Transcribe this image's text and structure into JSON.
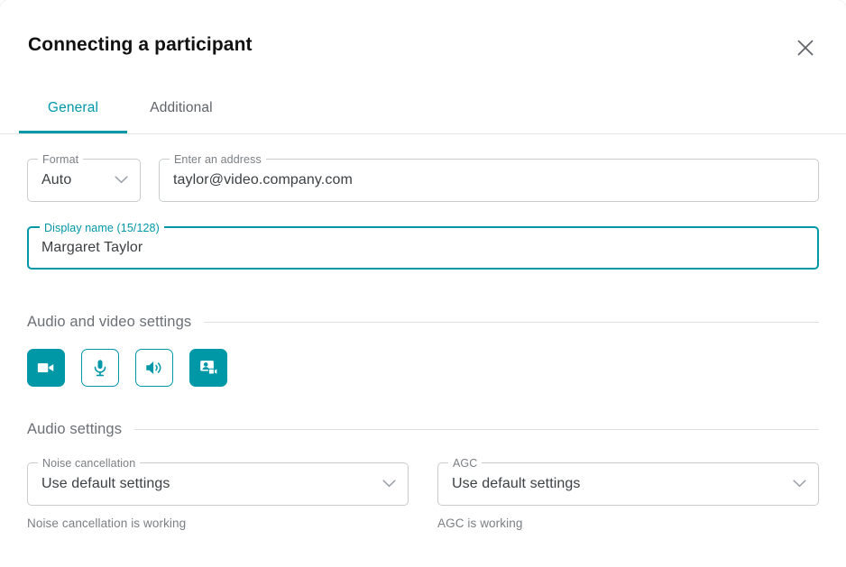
{
  "dialog": {
    "title": "Connecting a participant",
    "close_label": "×",
    "close_icon": "close-icon"
  },
  "tabs": [
    {
      "label": "General",
      "active": true
    },
    {
      "label": "Additional",
      "active": false
    }
  ],
  "form": {
    "format": {
      "label": "Format",
      "value": "Auto",
      "icon": "chevron-down-icon"
    },
    "address": {
      "label": "Enter an address",
      "value": "taylor@video.company.com",
      "placeholder": "Enter an address"
    },
    "display_name": {
      "label": "Display name (15/128)",
      "value": "Margaret Taylor",
      "placeholder": "Display name",
      "char_count": 15,
      "char_max": 128,
      "focused": true
    }
  },
  "av_section": {
    "title": "Audio and video settings",
    "buttons": [
      {
        "name": "camera-icon",
        "tooltip": "Camera",
        "filled": true
      },
      {
        "name": "microphone-icon",
        "tooltip": "Microphone",
        "filled": false
      },
      {
        "name": "speaker-icon",
        "tooltip": "Speaker",
        "filled": false
      },
      {
        "name": "presentation-icon",
        "tooltip": "Presentation",
        "filled": true
      }
    ]
  },
  "audio_section": {
    "title": "Audio settings",
    "noise_cancellation": {
      "label": "Noise cancellation",
      "value": "Use default settings",
      "help": "Noise cancellation is working",
      "icon": "chevron-down-icon"
    },
    "agc": {
      "label": "AGC",
      "value": "Use default settings",
      "help": "AGC is working",
      "icon": "chevron-down-icon"
    }
  },
  "colors": {
    "accent": "#0097a7",
    "text_primary": "#3c4043",
    "text_muted": "#7b7f83",
    "border": "#c9ccce",
    "divider": "#e0e0e0"
  }
}
